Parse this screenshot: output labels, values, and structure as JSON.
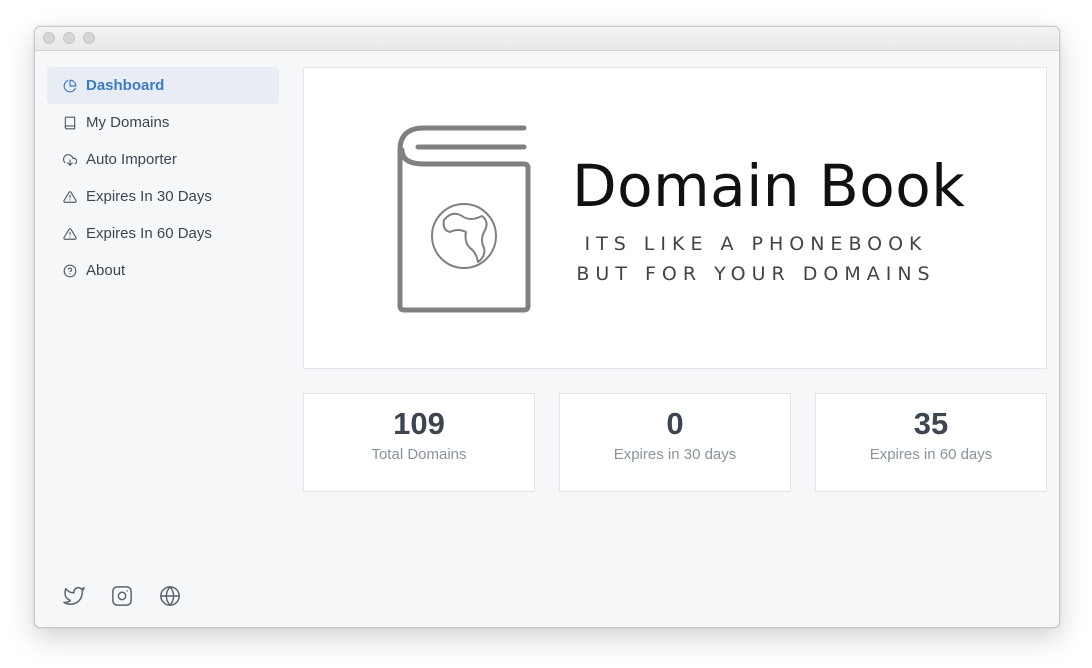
{
  "sidebar": {
    "items": [
      {
        "label": "Dashboard",
        "icon": "pie-chart-icon",
        "active": true
      },
      {
        "label": "My Domains",
        "icon": "book-icon"
      },
      {
        "label": "Auto Importer",
        "icon": "cloud-download-icon"
      },
      {
        "label": "Expires In 30 Days",
        "icon": "warning-icon"
      },
      {
        "label": "Expires In 60 Days",
        "icon": "warning-icon"
      },
      {
        "label": "About",
        "icon": "help-circle-icon"
      }
    ]
  },
  "social": [
    "twitter-icon",
    "instagram-icon",
    "globe-icon"
  ],
  "banner": {
    "title": "Domain Book",
    "tagline_line1": "ITS LIKE A PHONEBOOK",
    "tagline_line2": "BUT FOR YOUR DOMAINS"
  },
  "stats": [
    {
      "value": "109",
      "label": "Total Domains"
    },
    {
      "value": "0",
      "label": "Expires in 30 days"
    },
    {
      "value": "35",
      "label": "Expires in 60 days"
    }
  ],
  "colors": {
    "accent": "#3c7bc2",
    "active_bg": "#e8edf5",
    "text": "#3d4652",
    "muted": "#8a929c"
  }
}
